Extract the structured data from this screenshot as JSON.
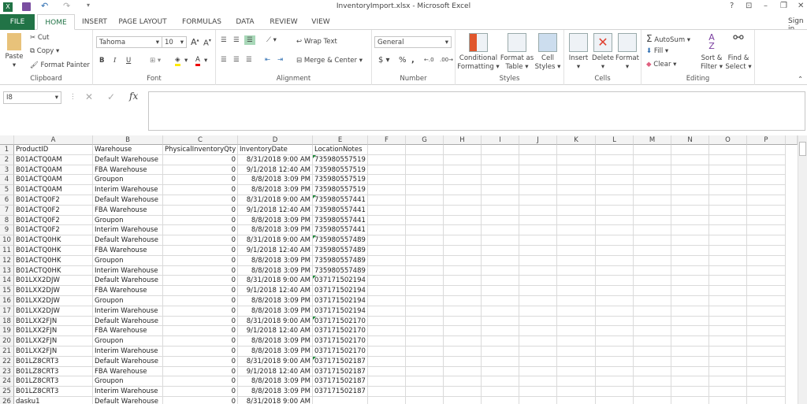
{
  "window": {
    "title": "InventoryImport.xlsx - Microsoft Excel",
    "help": "?",
    "sign_in": "Sign in"
  },
  "tabs": [
    "FILE",
    "HOME",
    "INSERT",
    "PAGE LAYOUT",
    "FORMULAS",
    "DATA",
    "REVIEW",
    "VIEW"
  ],
  "ribbon": {
    "clipboard": {
      "paste": "Paste",
      "cut": "Cut",
      "copy": "Copy",
      "format_painter": "Format Painter",
      "label": "Clipboard"
    },
    "font": {
      "name": "Tahoma",
      "size": "10",
      "bold": "B",
      "italic": "I",
      "underline": "U",
      "label": "Font"
    },
    "alignment": {
      "wrap_text": "Wrap Text",
      "merge_center": "Merge & Center",
      "label": "Alignment"
    },
    "number": {
      "format": "General",
      "currency": "$",
      "percent": "%",
      "comma": ",",
      "label": "Number"
    },
    "styles": {
      "conditional": "Conditional Formatting",
      "format_table": "Format as Table",
      "cell_styles": "Cell Styles",
      "label": "Styles"
    },
    "cells": {
      "insert": "Insert",
      "delete": "Delete",
      "format": "Format",
      "label": "Cells"
    },
    "editing": {
      "autosum": "AutoSum",
      "fill": "Fill",
      "clear": "Clear",
      "sort_filter": "Sort & Filter",
      "find_select": "Find & Select",
      "label": "Editing"
    }
  },
  "formula_bar": {
    "name_box": "I8",
    "fx": "fx",
    "value": ""
  },
  "columns": [
    "A",
    "B",
    "C",
    "D",
    "E",
    "F",
    "G",
    "H",
    "I",
    "J",
    "K",
    "L",
    "M",
    "N",
    "O",
    "P"
  ],
  "rows": [
    [
      "ProductID",
      "Warehouse",
      "PhysicalInventoryQty",
      "InventoryDate",
      "LocationNotes"
    ],
    [
      "B01ACTQ0AM",
      "Default Warehouse",
      "0",
      "8/31/2018 9:00 AM",
      "735980557519"
    ],
    [
      "B01ACTQ0AM",
      "FBA Warehouse",
      "0",
      "9/1/2018 12:40 AM",
      "735980557519"
    ],
    [
      "B01ACTQ0AM",
      "Groupon",
      "0",
      "8/8/2018 3:09 PM",
      "735980557519"
    ],
    [
      "B01ACTQ0AM",
      "Interim Warehouse",
      "0",
      "8/8/2018 3:09 PM",
      "735980557519"
    ],
    [
      "B01ACTQ0F2",
      "Default Warehouse",
      "0",
      "8/31/2018 9:00 AM",
      "735980557441"
    ],
    [
      "B01ACTQ0F2",
      "FBA Warehouse",
      "0",
      "9/1/2018 12:40 AM",
      "735980557441"
    ],
    [
      "B01ACTQ0F2",
      "Groupon",
      "0",
      "8/8/2018 3:09 PM",
      "735980557441"
    ],
    [
      "B01ACTQ0F2",
      "Interim Warehouse",
      "0",
      "8/8/2018 3:09 PM",
      "735980557441"
    ],
    [
      "B01ACTQ0HK",
      "Default Warehouse",
      "0",
      "8/31/2018 9:00 AM",
      "735980557489"
    ],
    [
      "B01ACTQ0HK",
      "FBA Warehouse",
      "0",
      "9/1/2018 12:40 AM",
      "735980557489"
    ],
    [
      "B01ACTQ0HK",
      "Groupon",
      "0",
      "8/8/2018 3:09 PM",
      "735980557489"
    ],
    [
      "B01ACTQ0HK",
      "Interim Warehouse",
      "0",
      "8/8/2018 3:09 PM",
      "735980557489"
    ],
    [
      "B01LXX2DJW",
      "Default Warehouse",
      "0",
      "8/31/2018 9:00 AM",
      "037171502194"
    ],
    [
      "B01LXX2DJW",
      "FBA Warehouse",
      "0",
      "9/1/2018 12:40 AM",
      "037171502194"
    ],
    [
      "B01LXX2DJW",
      "Groupon",
      "0",
      "8/8/2018 3:09 PM",
      "037171502194"
    ],
    [
      "B01LXX2DJW",
      "Interim Warehouse",
      "0",
      "8/8/2018 3:09 PM",
      "037171502194"
    ],
    [
      "B01LXX2FJN",
      "Default Warehouse",
      "0",
      "8/31/2018 9:00 AM",
      "037171502170"
    ],
    [
      "B01LXX2FJN",
      "FBA Warehouse",
      "0",
      "9/1/2018 12:40 AM",
      "037171502170"
    ],
    [
      "B01LXX2FJN",
      "Groupon",
      "0",
      "8/8/2018 3:09 PM",
      "037171502170"
    ],
    [
      "B01LXX2FJN",
      "Interim Warehouse",
      "0",
      "8/8/2018 3:09 PM",
      "037171502170"
    ],
    [
      "B01LZ8CRT3",
      "Default Warehouse",
      "0",
      "8/31/2018 9:00 AM",
      "037171502187"
    ],
    [
      "B01LZ8CRT3",
      "FBA Warehouse",
      "0",
      "9/1/2018 12:40 AM",
      "037171502187"
    ],
    [
      "B01LZ8CRT3",
      "Groupon",
      "0",
      "8/8/2018 3:09 PM",
      "037171502187"
    ],
    [
      "B01LZ8CRT3",
      "Interim Warehouse",
      "0",
      "8/8/2018 3:09 PM",
      "037171502187"
    ],
    [
      "dasku1",
      "Default Warehouse",
      "0",
      "8/31/2018 9:00 AM",
      ""
    ]
  ]
}
